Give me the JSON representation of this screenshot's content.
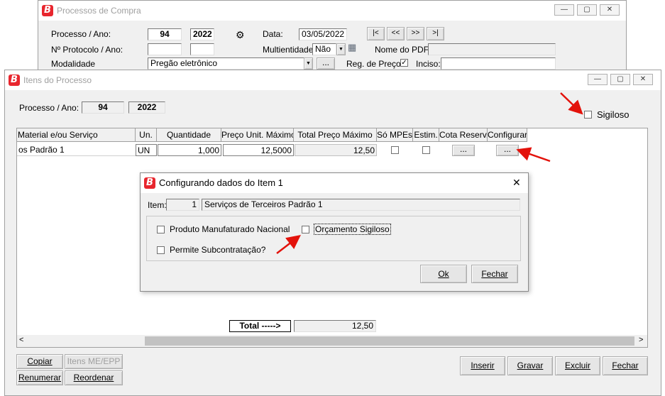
{
  "back_window": {
    "title": "Processos de Compra",
    "labels": {
      "processo_ano": "Processo / Ano:",
      "protocolo_ano": "Nº Protocolo / Ano:",
      "modalidade": "Modalidade",
      "data": "Data:",
      "multientidade": "Multientidade:",
      "nome_pdf": "Nome do PDF:",
      "reg_preco": "Reg. de Preço",
      "inciso": "Inciso:"
    },
    "processo": "94",
    "ano": "2022",
    "data": "03/05/2022",
    "multientidade": "Não",
    "modalidade": "Pregão eletrônico",
    "nav": [
      "|<",
      "<<",
      ">>",
      ">|"
    ],
    "ellipsis": "...",
    "reg_preco_checked": "✓"
  },
  "items_window": {
    "title": "Itens do Processo",
    "processo_label": "Processo / Ano:",
    "processo": "94",
    "ano": "2022",
    "sigiloso_label": "Sigiloso",
    "columns": [
      "Material e/ou Serviço",
      "Un.",
      "Quantidade",
      "Preço Unit. Máximo",
      "Total Preço Máximo",
      "Só MPEs",
      "Estim.",
      "Cota Reserv.",
      "Configurar"
    ],
    "row": {
      "material": "os Padrão 1",
      "un": "UN",
      "quantidade": "1,000",
      "preco_unit": "12,5000",
      "total": "12,50",
      "cota_btn": "...",
      "config_btn": "..."
    },
    "total_label": "Total ----->",
    "total_value": "12,50",
    "buttons": {
      "copiar": "Copiar",
      "itens_me": "Itens ME/EPP",
      "renumerar": "Renumerar",
      "reordenar": "Reordenar",
      "inserir": "Inserir",
      "gravar": "Gravar",
      "excluir": "Excluir",
      "fechar": "Fechar"
    }
  },
  "dialog": {
    "title": "Configurando dados do Item 1",
    "item_label": "Item:",
    "item_number": "1",
    "item_desc": "Serviços de Terceiros Padrão 1",
    "options": {
      "produto_nacional": "Produto Manufaturado Nacional",
      "orcamento_sigiloso": "Orçamento Sigiloso",
      "subcontratacao": "Permite Subcontratação?"
    },
    "ok": "Ok",
    "fechar": "Fechar"
  },
  "colors": {
    "annotation_red": "#e3120b",
    "logo_red": "#e8262e"
  }
}
